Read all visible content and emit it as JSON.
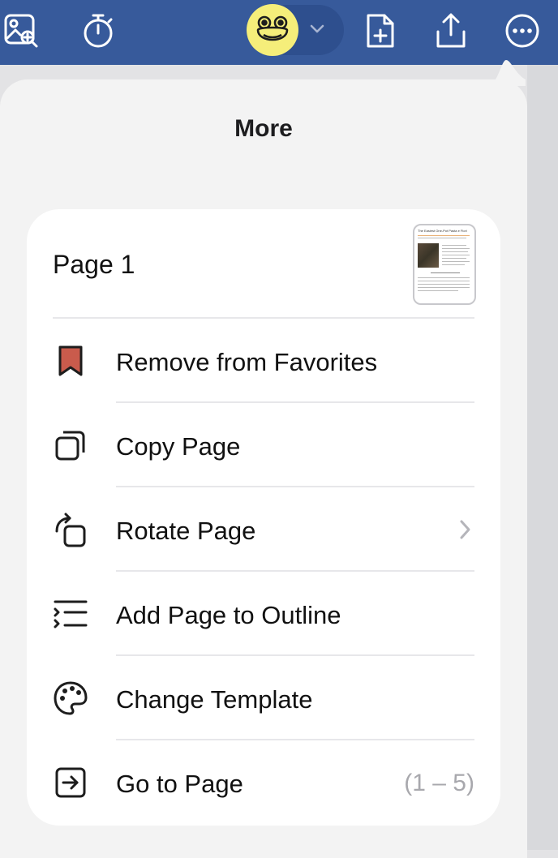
{
  "popover": {
    "title": "More"
  },
  "page": {
    "title": "Page 1",
    "thumbnail_title": "The Easiest One-Pot Pasta e Fiori"
  },
  "menu": {
    "items": [
      {
        "key": "remove-from-favorites",
        "label": "Remove from Favorites",
        "icon": "bookmark-icon",
        "color": "#c95b4c"
      },
      {
        "key": "copy-page",
        "label": "Copy Page",
        "icon": "copy-icon"
      },
      {
        "key": "rotate-page",
        "label": "Rotate Page",
        "icon": "rotate-icon",
        "has_submenu": true
      },
      {
        "key": "add-page-to-outline",
        "label": "Add Page to Outline",
        "icon": "outline-icon"
      },
      {
        "key": "change-template",
        "label": "Change Template",
        "icon": "palette-icon"
      },
      {
        "key": "go-to-page",
        "label": "Go to Page",
        "icon": "go-to-icon",
        "detail": "(1 – 5)"
      }
    ]
  },
  "colors": {
    "toolbar": "#375a9b",
    "avatar": "#f5ee7a",
    "favorite": "#c95b4c"
  }
}
